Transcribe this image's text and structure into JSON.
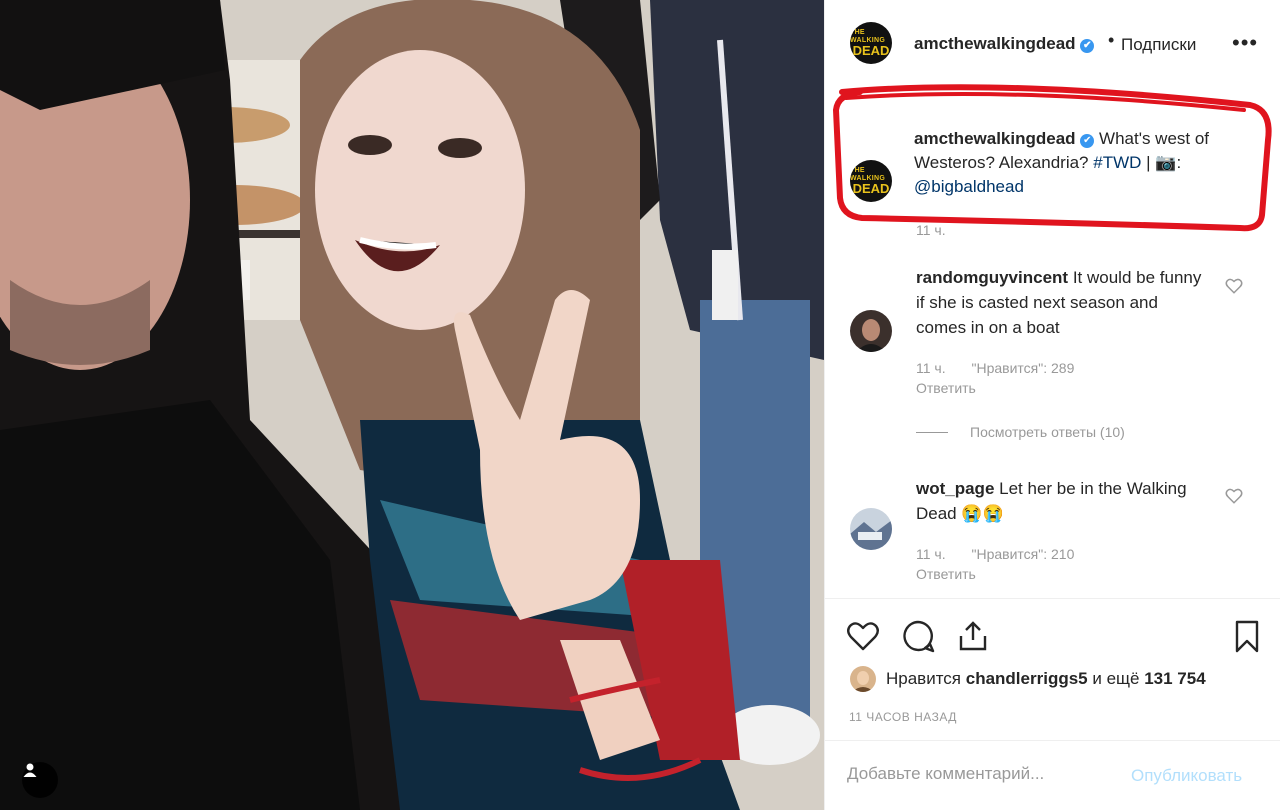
{
  "post": {
    "account": "amcthewalkingdead",
    "verified_mark": "✔",
    "follow_label": "Подписки",
    "dot": "•",
    "more_icon": "•••",
    "avatar_text_top": "THE WALKING",
    "avatar_text_bottom": "DEAD"
  },
  "caption": {
    "username": "amcthewalkingdead",
    "text": "What's west of Westeros? Alexandria?",
    "hashtag": "#TWD",
    "separator": "|",
    "camera": "📷",
    "colon": ":",
    "mention": "@bigbaldhead",
    "time": "11 ч."
  },
  "comments": [
    {
      "username": "randomguyvincent",
      "text": "It would be funny if she is casted next season and comes in on a boat",
      "time": "11 ч.",
      "likes": "\"Нравится\": 289",
      "reply": "Ответить"
    },
    {
      "username": "wot_page",
      "text": "Let her be in the Walking Dead",
      "emoji": "😭😭",
      "time": "11 ч.",
      "likes": "\"Нравится\": 210",
      "reply": "Ответить"
    }
  ],
  "view_replies": "Посмотреть ответы (10)",
  "likes_line": {
    "prefix": "Нравится",
    "liker": "chandlerriggs5",
    "middle": "и ещё",
    "count": "131 754"
  },
  "time_ago": "11 ЧАСОВ НАЗАД",
  "comment_box": {
    "placeholder": "Добавьте комментарий...",
    "publish_label": "Опубликовать"
  },
  "colors": {
    "link": "#003569",
    "verified": "#3897f0",
    "annotation": "#e0141e",
    "muted": "#999999"
  }
}
